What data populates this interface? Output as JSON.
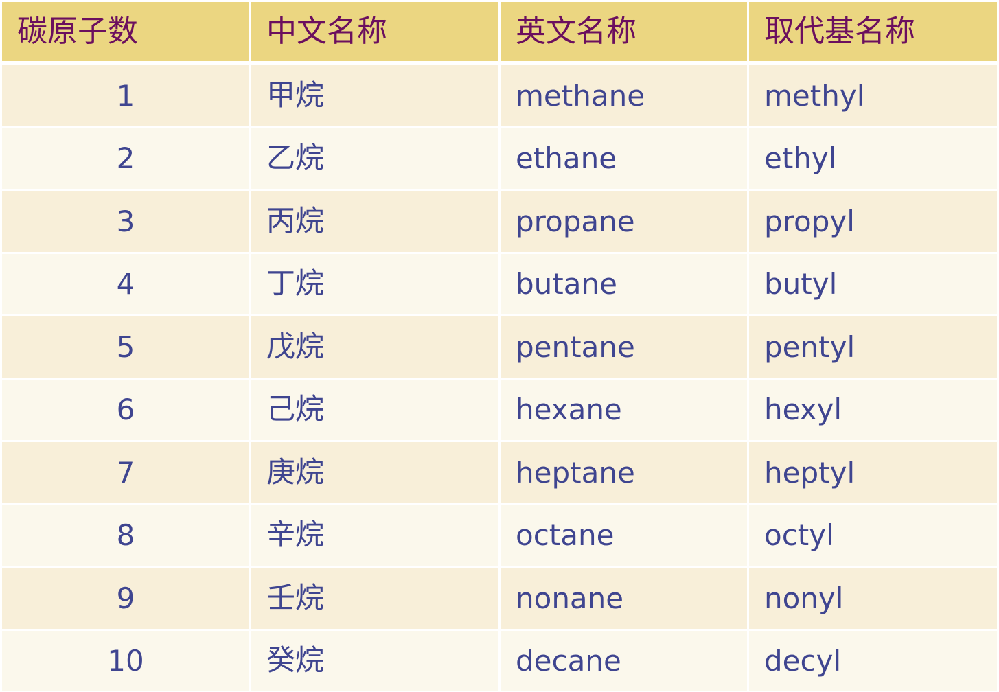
{
  "header": [
    "碳原子数",
    "中文名称",
    "英文名称",
    "取代基名称"
  ],
  "rows": [
    {
      "carbons": "1",
      "zh": "甲烷",
      "en": "methane",
      "substituent": "methyl"
    },
    {
      "carbons": "2",
      "zh": "乙烷",
      "en": "ethane",
      "substituent": "ethyl"
    },
    {
      "carbons": "3",
      "zh": "丙烷",
      "en": "propane",
      "substituent": "propyl"
    },
    {
      "carbons": "4",
      "zh": "丁烷",
      "en": "butane",
      "substituent": "butyl"
    },
    {
      "carbons": "5",
      "zh": "戊烷",
      "en": "pentane",
      "substituent": "pentyl"
    },
    {
      "carbons": "6",
      "zh": "己烷",
      "en": "hexane",
      "substituent": "hexyl"
    },
    {
      "carbons": "7",
      "zh": "庚烷",
      "en": "heptane",
      "substituent": "heptyl"
    },
    {
      "carbons": "8",
      "zh": "辛烷",
      "en": "octane",
      "substituent": "octyl"
    },
    {
      "carbons": "9",
      "zh": "壬烷",
      "en": "nonane",
      "substituent": "nonyl"
    },
    {
      "carbons": "10",
      "zh": "癸烷",
      "en": "decane",
      "substituent": "decyl"
    }
  ],
  "colors": {
    "header_bg": "#ebd681",
    "header_text": "#6b0f5e",
    "row_odd": "#f8efd9",
    "row_even": "#fbf8ec",
    "body_text": "#3f4590"
  }
}
